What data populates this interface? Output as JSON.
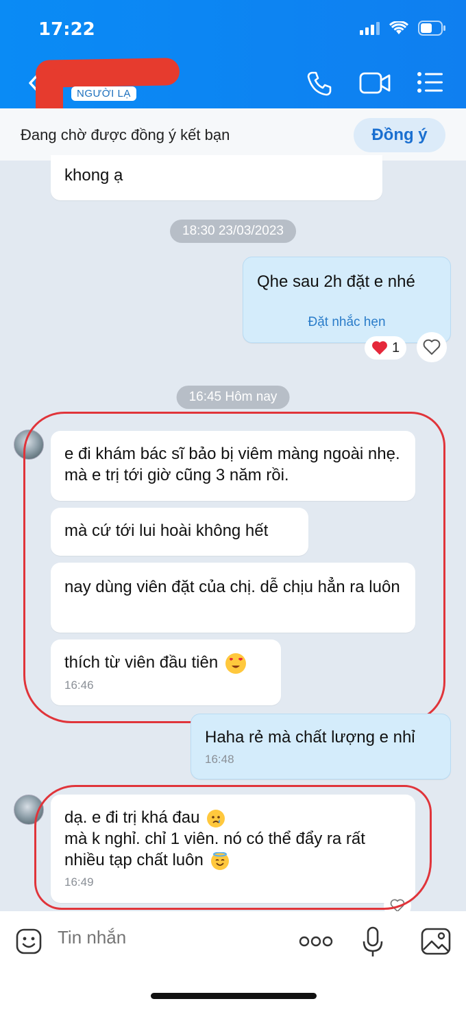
{
  "status_bar": {
    "time": "17:22"
  },
  "header": {
    "badge": "NGƯỜI LẠ",
    "icons": [
      "back-icon",
      "phone-icon",
      "video-call-icon",
      "menu-list-icon"
    ]
  },
  "friend_request": {
    "text": "Đang chờ được đồng ý kết bạn",
    "accept_label": "Đồng ý"
  },
  "messages": {
    "m0_text": "khong ạ",
    "ts1": "18:30 23/03/2023",
    "m1_text": "Qhe sau 2h đặt e nhé",
    "m1_reminder": "Đặt nhắc hẹn",
    "m1_reaction_count": "1",
    "ts2": "16:45 Hôm nay",
    "m2_text": "e đi khám bác sĩ bảo bị viêm màng ngoài nhẹ. mà e trị tới giờ cũng 3 năm rồi.",
    "m3_text": "mà cứ tới lui hoài không hết",
    "m4_text": "nay dùng viên đặt của chị. dễ chịu hẳn ra luôn",
    "m5_text": "thích từ viên đầu tiên",
    "m5_time": "16:46",
    "m6_text": "Haha rẻ mà chất lượng e nhỉ",
    "m6_time": "16:48",
    "m7_line1": "dạ. e đi trị khá đau",
    "m7_line2": "mà k nghỉ. chỉ 1 viên. nó có thể đẩy ra rất nhiều tạp chất luôn",
    "m7_time": "16:49"
  },
  "composer": {
    "placeholder": "Tin nhắn",
    "icons": [
      "sticker-icon",
      "more-icon",
      "microphone-icon",
      "image-icon"
    ]
  },
  "colors": {
    "header_blue": "#0a8bf5",
    "accent_blue": "#1a6fd0",
    "annotation_red": "#e0343a"
  }
}
